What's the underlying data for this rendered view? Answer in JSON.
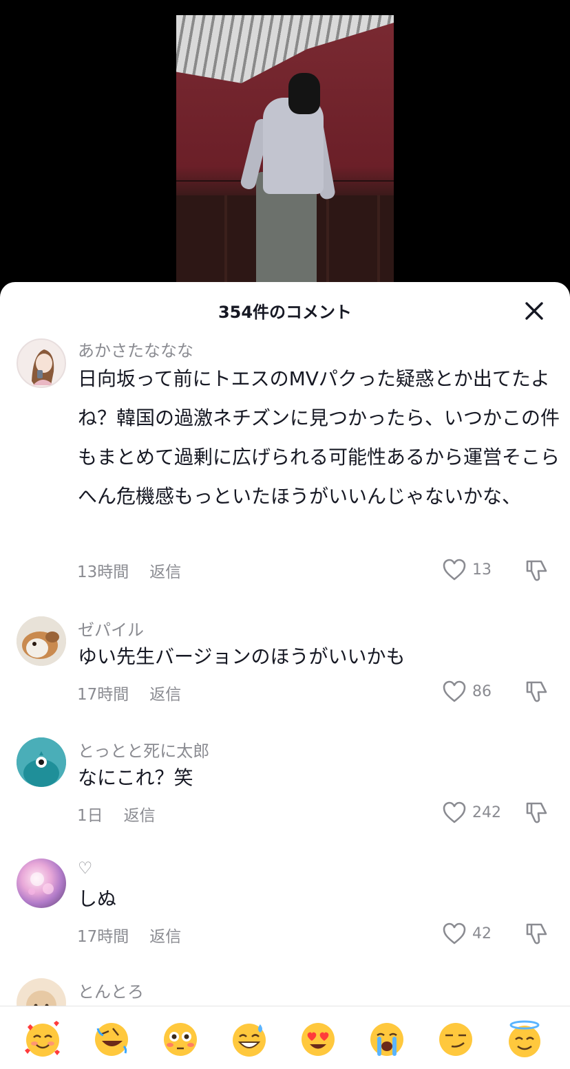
{
  "header": {
    "title": "354件のコメント"
  },
  "comments": [
    {
      "username": "あかさたななな",
      "text": "日向坂って前にトエスのMVパクった疑惑とか出てたよね？韓国の過激ネチズンに見つかったら、いつかこの件もまとめて過剰に広げられる可能性あるから運営そこらへん危機感もっといたほうがいいんじゃないかな、",
      "time": "13時間",
      "reply": "返信",
      "likes": "13"
    },
    {
      "username": "ゼパイル",
      "text": "ゆい先生バージョンのほうがいいかも",
      "time": "17時間",
      "reply": "返信",
      "likes": "86"
    },
    {
      "username": "とっとと死に太郎",
      "text": "なにこれ？笑",
      "time": "1日",
      "reply": "返信",
      "likes": "242"
    },
    {
      "username": "♡",
      "text": "しぬ",
      "time": "17時間",
      "reply": "返信",
      "likes": "42"
    },
    {
      "username": "とんとろ"
    }
  ],
  "emoji_bar": [
    "smiling-face-with-hearts",
    "rolling-on-floor-laughing",
    "flushed-face",
    "grinning-face-with-sweat",
    "heart-eyes",
    "loudly-crying-face",
    "smirking-face",
    "smiling-face-with-halo"
  ],
  "colors": {
    "primary_text": "#161823",
    "secondary_text": "#8a8b91",
    "background": "#ffffff"
  }
}
